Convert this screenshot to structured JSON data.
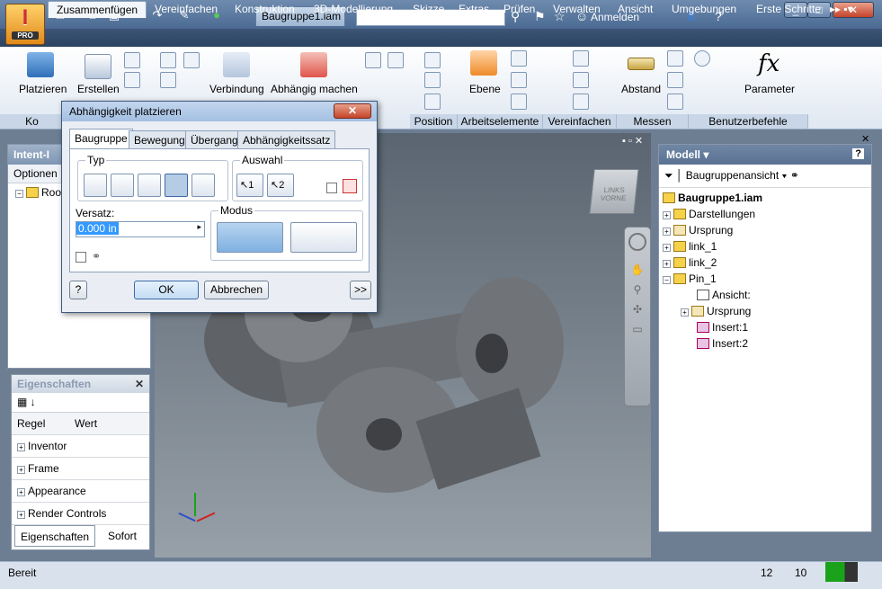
{
  "app": {
    "pro_label": "PRO",
    "doc_tab": "Baugruppe1.iam",
    "sign_in": "Anmelden"
  },
  "tabs": [
    "Zusammenfügen",
    "Vereinfachen",
    "Konstruktion",
    "3D-Modellierung",
    "Skizze",
    "Extras",
    "Prüfen",
    "Verwalten",
    "Ansicht",
    "Umgebungen",
    "Erste Schritte"
  ],
  "ribbon": {
    "place": "Platzieren",
    "create": "Erstellen",
    "joint": "Verbindung",
    "constrain": "Abhängig machen",
    "plane": "Ebene",
    "distance": "Abstand",
    "parameter": "Parameter",
    "parameter_glyph": "fx",
    "panels": [
      "Ko",
      "Position",
      "Arbeitselemente",
      "Vereinfachen",
      "Messen",
      "Benutzerbefehle"
    ]
  },
  "left_pane": {
    "title": "Intent-I",
    "options": "Optionen",
    "root": "Roo"
  },
  "properties": {
    "title": "Eigenschaften",
    "col_rule": "Regel",
    "col_value": "Wert",
    "rows": [
      "Inventor",
      "Frame",
      "Appearance",
      "Render Controls"
    ],
    "tab_props": "Eigenschaften",
    "tab_instant": "Sofort"
  },
  "browser": {
    "title": "Modell",
    "view": "Baugruppenansicht",
    "root": "Baugruppe1.iam",
    "items": [
      "Darstellungen",
      "Ursprung",
      "link_1",
      "link_2",
      "Pin_1",
      "Ansicht:",
      "Ursprung",
      "Insert:1",
      "Insert:2"
    ]
  },
  "viewcube": {
    "left": "LINKS",
    "front": "VORNE"
  },
  "dialog": {
    "title": "Abhängigkeit platzieren",
    "tabs": [
      "Baugruppe",
      "Bewegung",
      "Übergang",
      "Abhängigkeitssatz"
    ],
    "type_label": "Typ",
    "selection_label": "Auswahl",
    "sel1": "1",
    "sel2": "2",
    "offset_label": "Versatz:",
    "offset_value": "0.000 in",
    "mode_label": "Modus",
    "ok": "OK",
    "cancel": "Abbrechen",
    "more": ">>",
    "help": "?"
  },
  "status": {
    "text": "Bereit",
    "count1": "12",
    "count2": "10"
  },
  "colors": {
    "ribbon_tab_bg": "#2c4362",
    "accent_green": "#1aa31a"
  }
}
